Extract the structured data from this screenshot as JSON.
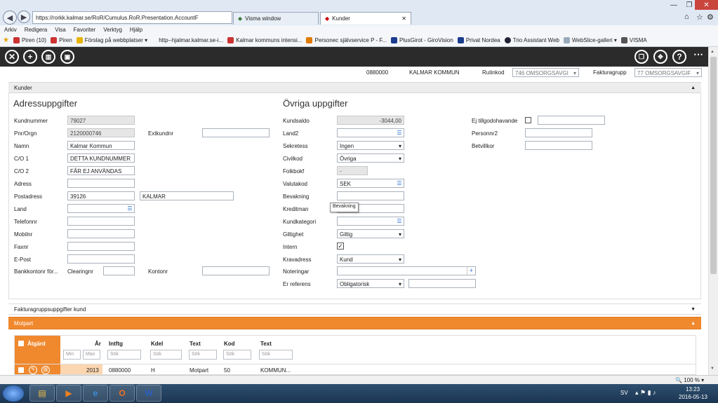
{
  "browser": {
    "url": "https://rorkk.kalmar.se/RoR/Cumulus.RoR.Presentation.AccountF",
    "tabs": [
      {
        "label": "Visma window"
      },
      {
        "label": "Kunder"
      }
    ],
    "menu": [
      "Arkiv",
      "Redigera",
      "Visa",
      "Favoriter",
      "Verktyg",
      "Hjälp"
    ],
    "favorites": [
      {
        "label": "Piren (10)"
      },
      {
        "label": "Piren"
      },
      {
        "label": "Förslag på webbplatser ▾"
      },
      {
        "label": "http--hjalmar.kalmar.se-i..."
      },
      {
        "label": "Kalmar kommuns intensi..."
      },
      {
        "label": "Personec självservice P - F..."
      },
      {
        "label": "PlusGirot - GiroVision"
      },
      {
        "label": "Privat  Nordea"
      },
      {
        "label": "Trio Assistant Web"
      },
      {
        "label": "WebSlice-galleri ▾"
      },
      {
        "label": "VISMA"
      }
    ]
  },
  "header": {
    "customer_no": "0880000",
    "customer_name": "KALMAR KOMMUN",
    "rutinkod_label": "Rutinkod",
    "rutinkod_value": "746 OMSORGSAVGI",
    "fakturagrupp_label": "Fakturagrupp",
    "fakturagrupp_value": "77 OMSORGSAVGIF"
  },
  "panel": {
    "title": "Kunder",
    "adress_title": "Adressuppgifter",
    "ovriga_title": "Övriga uppgifter"
  },
  "adress": {
    "kundnummer_label": "Kundnummer",
    "kundnummer": "79027",
    "pnr_label": "Pnr/Orgn",
    "pnr": "2120000746",
    "extkundnr_label": "Extkundnr",
    "extkundnr": "",
    "namn_label": "Namn",
    "namn": "Kalmar Kommun",
    "co1_label": "C/O 1",
    "co1": "DETTA KUNDNUMMER",
    "co2_label": "C/O 2",
    "co2": "FÅR EJ ANVÄNDAS",
    "adress_label": "Adress",
    "adress": "",
    "postadress_label": "Postadress",
    "postnr": "39126",
    "ort": "KALMAR",
    "land_label": "Land",
    "land": "",
    "telefon_label": "Telefonnr",
    "telefon": "",
    "mobil_label": "Mobilnr",
    "mobil": "",
    "fax_label": "Faxnr",
    "fax": "",
    "epost_label": "E-Post",
    "epost": "",
    "bank_label": "Bankkontonr för...",
    "clearing_label": "Clearingnr",
    "clearing": "",
    "kontonr_label": "Kontonr",
    "kontonr": ""
  },
  "ovriga": {
    "kundsaldo_label": "Kundsaldo",
    "kundsaldo": "-3044,00",
    "land2_label": "Land2",
    "land2": "",
    "sekretess_label": "Sekretess",
    "sekretess": "Ingen",
    "civilkod_label": "Civilkod",
    "civilkod": "Övriga",
    "folkbokf_label": "Folkbokf",
    "folkbokf": "-",
    "valutakod_label": "Valutakod",
    "valutakod": "SEK",
    "bevakning_label": "Bevakning",
    "bevakning": "",
    "bevakning_tooltip": "Bevakning",
    "kreditman_label": "Kreditman",
    "kreditman": "",
    "kundkategori_label": "Kundkategori",
    "kundkategori": "",
    "giltighet_label": "Giltighet",
    "giltighet": "Giltig",
    "intern_label": "Intern",
    "intern_checked": true,
    "kravadress_label": "Kravadress",
    "kravadress": "Kund",
    "noteringar_label": "Noteringar",
    "noteringar": "",
    "er_referens_label": "Er referens",
    "er_referens": "Obligatorisk",
    "er_referens_text": "",
    "ej_tillgodo_label": "Ej tillgodohavande",
    "ej_tillgodo_checked": false,
    "ej_tillgodo_text": "",
    "personnr2_label": "Personnr2",
    "personnr2": "",
    "betvillkor_label": "Betvillkor",
    "betvillkor": ""
  },
  "faktura_panel": {
    "title": "Fakturagruppsuppgifter kund"
  },
  "motpart": {
    "title": "Motpart",
    "columns": {
      "atgard": "Åtgärd",
      "ar": "År",
      "intftg": "Intftg",
      "kdel": "Kdel",
      "text": "Text",
      "kod": "Kod",
      "text2": "Text"
    },
    "filters": {
      "min": "Min",
      "max": "Max",
      "sok": "Sök"
    },
    "rows": [
      {
        "ar": "2013",
        "intftg": "0880000",
        "kdel": "H",
        "text": "Motpart",
        "kod": "50",
        "text2": "KOMMUN..."
      }
    ]
  },
  "status": {
    "zoom": "100 %"
  },
  "taskbar": {
    "lang": "SV",
    "time": "13:23",
    "date": "2016-05-13"
  }
}
